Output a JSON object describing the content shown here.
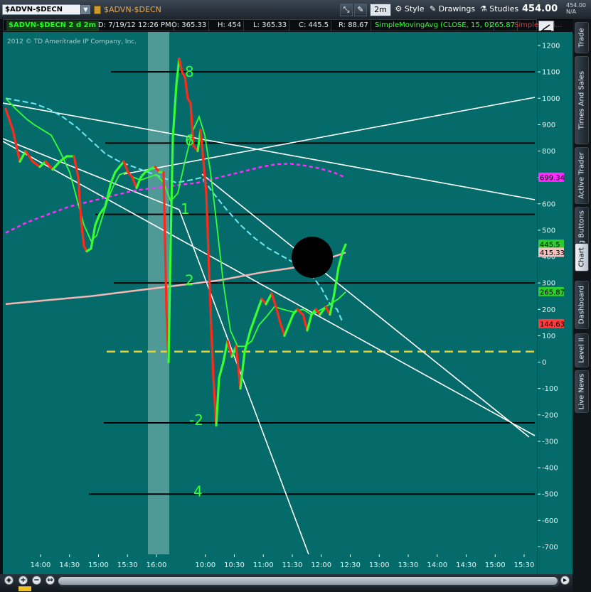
{
  "header": {
    "symbol": "$ADVN-$DECN",
    "linked_symbol": "$ADVN-$DECN",
    "timeframe": "2m",
    "style_label": "Style",
    "drawings_label": "Drawings",
    "studies_label": "Studies",
    "last_price": "454.00",
    "mini_price": "454.00",
    "mini_change": "N/A"
  },
  "infobar": {
    "title": "$ADVN-$DECN 2 d 2m",
    "date": "D: 7/19/12 12:26 PM",
    "open": "O: 365.33",
    "high": "H: 454",
    "low": "L: 365.33",
    "close": "C: 445.5",
    "range": "R: 88.67",
    "study": "SimpleMovingAvg (CLOSE, 15, 0)",
    "study_value": "265.87",
    "study2": "SimpleMovi..."
  },
  "copyright": "2012 © TD Ameritrade IP Company, Inc.",
  "side_tabs": [
    "Trade",
    "Times And Sales",
    "Active Trader",
    "Big Buttons",
    "Chart",
    "Dashboard",
    "Level II",
    "Live News"
  ],
  "active_tab": "Chart",
  "colors": {
    "background": "#056b6a",
    "up_bar": "#33ff33",
    "down_bar": "#ff2a1a",
    "sma_fast": "#33ff33",
    "sma_cyan": "#6fe8f5",
    "sma_magenta": "#ff2cff",
    "sma_pink": "#f3b6b6",
    "zero_line": "#f2d21e",
    "support_lines": "#000000",
    "trend_lines": "#ffffff"
  },
  "chart_data": {
    "type": "line",
    "title": "$ADVN-$DECN 2 d 2m",
    "ylim": [
      -730,
      1250
    ],
    "y_ticks": [
      1200,
      1100,
      1000,
      900,
      800,
      700,
      600,
      500,
      400,
      300,
      200,
      100,
      0,
      -100,
      -200,
      -300,
      -400,
      -500,
      -600,
      -700
    ],
    "x_ticks": [
      "14:00",
      "14:30",
      "15:00",
      "15:30",
      "16:00",
      "10:00",
      "10:30",
      "11:00",
      "11:30",
      "12:00",
      "12:30",
      "13:00",
      "13:30",
      "14:00",
      "14:30",
      "15:00",
      "15:30"
    ],
    "price_path": [
      [
        0,
        960
      ],
      [
        10,
        880
      ],
      [
        20,
        760
      ],
      [
        28,
        800
      ],
      [
        38,
        760
      ],
      [
        48,
        740
      ],
      [
        56,
        760
      ],
      [
        66,
        730
      ],
      [
        76,
        760
      ],
      [
        86,
        780
      ],
      [
        96,
        780
      ],
      [
        102,
        700
      ],
      [
        106,
        540
      ],
      [
        110,
        440
      ],
      [
        114,
        420
      ],
      [
        120,
        430
      ],
      [
        126,
        520
      ],
      [
        132,
        560
      ],
      [
        140,
        590
      ],
      [
        148,
        680
      ],
      [
        154,
        720
      ],
      [
        160,
        740
      ],
      [
        166,
        760
      ],
      [
        172,
        720
      ],
      [
        178,
        700
      ],
      [
        184,
        660
      ],
      [
        190,
        700
      ],
      [
        196,
        720
      ],
      [
        202,
        730
      ],
      [
        210,
        740
      ],
      [
        216,
        720
      ],
      [
        222,
        720
      ],
      [
        226,
        200
      ],
      [
        229,
        0
      ],
      [
        232,
        460
      ],
      [
        235,
        850
      ],
      [
        240,
        1050
      ],
      [
        244,
        1150
      ],
      [
        248,
        1100
      ],
      [
        252,
        1080
      ],
      [
        256,
        1000
      ],
      [
        260,
        980
      ],
      [
        264,
        820
      ],
      [
        270,
        800
      ],
      [
        274,
        880
      ],
      [
        278,
        760
      ],
      [
        282,
        640
      ],
      [
        288,
        200
      ],
      [
        292,
        -60
      ],
      [
        296,
        -240
      ],
      [
        300,
        -60
      ],
      [
        306,
        0
      ],
      [
        312,
        80
      ],
      [
        318,
        20
      ],
      [
        324,
        60
      ],
      [
        330,
        -100
      ],
      [
        336,
        40
      ],
      [
        344,
        120
      ],
      [
        352,
        180
      ],
      [
        360,
        240
      ],
      [
        366,
        220
      ],
      [
        374,
        260
      ],
      [
        380,
        210
      ],
      [
        386,
        150
      ],
      [
        392,
        100
      ],
      [
        398,
        140
      ],
      [
        404,
        180
      ],
      [
        410,
        200
      ],
      [
        418,
        180
      ],
      [
        424,
        120
      ],
      [
        430,
        180
      ],
      [
        436,
        200
      ],
      [
        442,
        180
      ],
      [
        450,
        210
      ],
      [
        456,
        180
      ],
      [
        462,
        260
      ],
      [
        468,
        360
      ],
      [
        474,
        420
      ],
      [
        478,
        445.5
      ]
    ],
    "sma_green": [
      [
        0,
        1000
      ],
      [
        14,
        960
      ],
      [
        30,
        920
      ],
      [
        40,
        900
      ],
      [
        52,
        880
      ],
      [
        64,
        860
      ],
      [
        76,
        800
      ],
      [
        90,
        720
      ],
      [
        100,
        620
      ],
      [
        110,
        520
      ],
      [
        120,
        460
      ],
      [
        128,
        480
      ],
      [
        136,
        550
      ],
      [
        144,
        620
      ],
      [
        152,
        670
      ],
      [
        160,
        710
      ],
      [
        170,
        720
      ],
      [
        180,
        700
      ],
      [
        190,
        690
      ],
      [
        200,
        700
      ],
      [
        212,
        710
      ],
      [
        222,
        680
      ],
      [
        232,
        610
      ],
      [
        242,
        640
      ],
      [
        252,
        760
      ],
      [
        262,
        870
      ],
      [
        272,
        930
      ],
      [
        280,
        860
      ],
      [
        288,
        720
      ],
      [
        296,
        540
      ],
      [
        306,
        300
      ],
      [
        316,
        120
      ],
      [
        326,
        60
      ],
      [
        336,
        60
      ],
      [
        346,
        80
      ],
      [
        356,
        140
      ],
      [
        366,
        170
      ],
      [
        378,
        210
      ],
      [
        390,
        200
      ],
      [
        404,
        190
      ],
      [
        418,
        200
      ],
      [
        430,
        180
      ],
      [
        444,
        200
      ],
      [
        456,
        220
      ],
      [
        468,
        240
      ],
      [
        478,
        265.87
      ]
    ],
    "sma_cyan": [
      [
        0,
        1000
      ],
      [
        20,
        990
      ],
      [
        40,
        980
      ],
      [
        60,
        960
      ],
      [
        80,
        930
      ],
      [
        100,
        890
      ],
      [
        120,
        840
      ],
      [
        140,
        790
      ],
      [
        160,
        760
      ],
      [
        180,
        740
      ],
      [
        200,
        720
      ],
      [
        220,
        700
      ],
      [
        240,
        680
      ],
      [
        260,
        690
      ],
      [
        276,
        700
      ],
      [
        292,
        640
      ],
      [
        310,
        580
      ],
      [
        330,
        520
      ],
      [
        350,
        470
      ],
      [
        370,
        430
      ],
      [
        390,
        400
      ],
      [
        410,
        370
      ],
      [
        430,
        330
      ],
      [
        444,
        280
      ],
      [
        456,
        220
      ],
      [
        466,
        200
      ],
      [
        474,
        150
      ]
    ],
    "sma_magenta": [
      [
        0,
        490
      ],
      [
        30,
        530
      ],
      [
        60,
        560
      ],
      [
        90,
        590
      ],
      [
        120,
        610
      ],
      [
        150,
        630
      ],
      [
        180,
        650
      ],
      [
        210,
        660
      ],
      [
        240,
        670
      ],
      [
        270,
        680
      ],
      [
        300,
        700
      ],
      [
        330,
        720
      ],
      [
        360,
        740
      ],
      [
        380,
        750
      ],
      [
        400,
        752
      ],
      [
        420,
        745
      ],
      [
        440,
        735
      ],
      [
        460,
        720
      ],
      [
        478,
        699.34
      ]
    ],
    "sma_pink": [
      [
        0,
        220
      ],
      [
        60,
        235
      ],
      [
        120,
        250
      ],
      [
        180,
        270
      ],
      [
        240,
        290
      ],
      [
        300,
        310
      ],
      [
        360,
        340
      ],
      [
        410,
        360
      ],
      [
        450,
        390
      ],
      [
        478,
        415.33
      ]
    ],
    "horizontal_levels": [
      1100,
      830,
      560,
      300,
      40,
      -230,
      -500
    ],
    "price_labels": [
      {
        "label": "445.5",
        "value": 445.5,
        "color": "#2ecc2e"
      },
      {
        "label": "415.33",
        "value": 415.33,
        "color": "#f4c0c0"
      },
      {
        "label": "699.34",
        "value": 699.34,
        "color": "#ff2cff"
      },
      {
        "label": "265.87",
        "value": 265.87,
        "color": "#2ecc2e"
      },
      {
        "label": "144.63",
        "value": 144.63,
        "color": "#ff3b3b"
      }
    ],
    "wave_labels": [
      {
        "text": "8",
        "value": 1100
      },
      {
        "text": "6",
        "value": 840
      },
      {
        "text": "1",
        "value": 580
      },
      {
        "text": "2",
        "value": 310
      },
      {
        "text": "-2",
        "value": -220
      },
      {
        "text": "4",
        "value": -490
      }
    ]
  }
}
